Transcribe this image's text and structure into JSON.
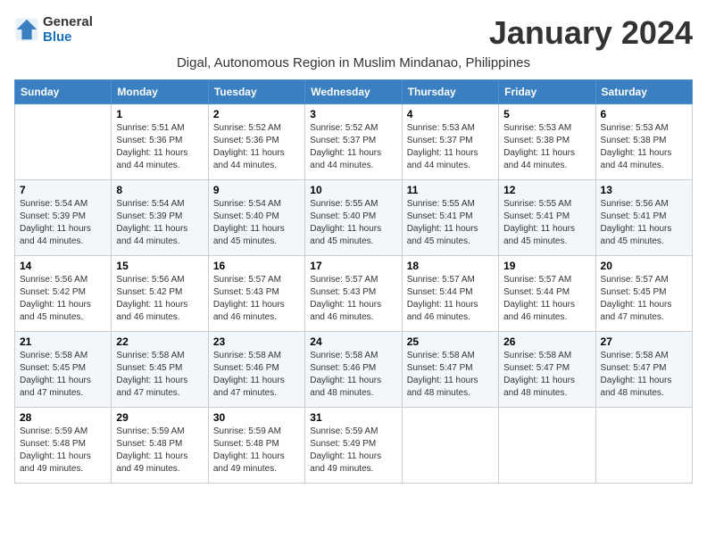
{
  "logo": {
    "general": "General",
    "blue": "Blue"
  },
  "title": "January 2024",
  "subtitle": "Digal, Autonomous Region in Muslim Mindanao, Philippines",
  "headers": [
    "Sunday",
    "Monday",
    "Tuesday",
    "Wednesday",
    "Thursday",
    "Friday",
    "Saturday"
  ],
  "weeks": [
    [
      {
        "day": "",
        "sunrise": "",
        "sunset": "",
        "daylight": ""
      },
      {
        "day": "1",
        "sunrise": "Sunrise: 5:51 AM",
        "sunset": "Sunset: 5:36 PM",
        "daylight": "Daylight: 11 hours and 44 minutes."
      },
      {
        "day": "2",
        "sunrise": "Sunrise: 5:52 AM",
        "sunset": "Sunset: 5:36 PM",
        "daylight": "Daylight: 11 hours and 44 minutes."
      },
      {
        "day": "3",
        "sunrise": "Sunrise: 5:52 AM",
        "sunset": "Sunset: 5:37 PM",
        "daylight": "Daylight: 11 hours and 44 minutes."
      },
      {
        "day": "4",
        "sunrise": "Sunrise: 5:53 AM",
        "sunset": "Sunset: 5:37 PM",
        "daylight": "Daylight: 11 hours and 44 minutes."
      },
      {
        "day": "5",
        "sunrise": "Sunrise: 5:53 AM",
        "sunset": "Sunset: 5:38 PM",
        "daylight": "Daylight: 11 hours and 44 minutes."
      },
      {
        "day": "6",
        "sunrise": "Sunrise: 5:53 AM",
        "sunset": "Sunset: 5:38 PM",
        "daylight": "Daylight: 11 hours and 44 minutes."
      }
    ],
    [
      {
        "day": "7",
        "sunrise": "Sunrise: 5:54 AM",
        "sunset": "Sunset: 5:39 PM",
        "daylight": "Daylight: 11 hours and 44 minutes."
      },
      {
        "day": "8",
        "sunrise": "Sunrise: 5:54 AM",
        "sunset": "Sunset: 5:39 PM",
        "daylight": "Daylight: 11 hours and 44 minutes."
      },
      {
        "day": "9",
        "sunrise": "Sunrise: 5:54 AM",
        "sunset": "Sunset: 5:40 PM",
        "daylight": "Daylight: 11 hours and 45 minutes."
      },
      {
        "day": "10",
        "sunrise": "Sunrise: 5:55 AM",
        "sunset": "Sunset: 5:40 PM",
        "daylight": "Daylight: 11 hours and 45 minutes."
      },
      {
        "day": "11",
        "sunrise": "Sunrise: 5:55 AM",
        "sunset": "Sunset: 5:41 PM",
        "daylight": "Daylight: 11 hours and 45 minutes."
      },
      {
        "day": "12",
        "sunrise": "Sunrise: 5:55 AM",
        "sunset": "Sunset: 5:41 PM",
        "daylight": "Daylight: 11 hours and 45 minutes."
      },
      {
        "day": "13",
        "sunrise": "Sunrise: 5:56 AM",
        "sunset": "Sunset: 5:41 PM",
        "daylight": "Daylight: 11 hours and 45 minutes."
      }
    ],
    [
      {
        "day": "14",
        "sunrise": "Sunrise: 5:56 AM",
        "sunset": "Sunset: 5:42 PM",
        "daylight": "Daylight: 11 hours and 45 minutes."
      },
      {
        "day": "15",
        "sunrise": "Sunrise: 5:56 AM",
        "sunset": "Sunset: 5:42 PM",
        "daylight": "Daylight: 11 hours and 46 minutes."
      },
      {
        "day": "16",
        "sunrise": "Sunrise: 5:57 AM",
        "sunset": "Sunset: 5:43 PM",
        "daylight": "Daylight: 11 hours and 46 minutes."
      },
      {
        "day": "17",
        "sunrise": "Sunrise: 5:57 AM",
        "sunset": "Sunset: 5:43 PM",
        "daylight": "Daylight: 11 hours and 46 minutes."
      },
      {
        "day": "18",
        "sunrise": "Sunrise: 5:57 AM",
        "sunset": "Sunset: 5:44 PM",
        "daylight": "Daylight: 11 hours and 46 minutes."
      },
      {
        "day": "19",
        "sunrise": "Sunrise: 5:57 AM",
        "sunset": "Sunset: 5:44 PM",
        "daylight": "Daylight: 11 hours and 46 minutes."
      },
      {
        "day": "20",
        "sunrise": "Sunrise: 5:57 AM",
        "sunset": "Sunset: 5:45 PM",
        "daylight": "Daylight: 11 hours and 47 minutes."
      }
    ],
    [
      {
        "day": "21",
        "sunrise": "Sunrise: 5:58 AM",
        "sunset": "Sunset: 5:45 PM",
        "daylight": "Daylight: 11 hours and 47 minutes."
      },
      {
        "day": "22",
        "sunrise": "Sunrise: 5:58 AM",
        "sunset": "Sunset: 5:45 PM",
        "daylight": "Daylight: 11 hours and 47 minutes."
      },
      {
        "day": "23",
        "sunrise": "Sunrise: 5:58 AM",
        "sunset": "Sunset: 5:46 PM",
        "daylight": "Daylight: 11 hours and 47 minutes."
      },
      {
        "day": "24",
        "sunrise": "Sunrise: 5:58 AM",
        "sunset": "Sunset: 5:46 PM",
        "daylight": "Daylight: 11 hours and 48 minutes."
      },
      {
        "day": "25",
        "sunrise": "Sunrise: 5:58 AM",
        "sunset": "Sunset: 5:47 PM",
        "daylight": "Daylight: 11 hours and 48 minutes."
      },
      {
        "day": "26",
        "sunrise": "Sunrise: 5:58 AM",
        "sunset": "Sunset: 5:47 PM",
        "daylight": "Daylight: 11 hours and 48 minutes."
      },
      {
        "day": "27",
        "sunrise": "Sunrise: 5:58 AM",
        "sunset": "Sunset: 5:47 PM",
        "daylight": "Daylight: 11 hours and 48 minutes."
      }
    ],
    [
      {
        "day": "28",
        "sunrise": "Sunrise: 5:59 AM",
        "sunset": "Sunset: 5:48 PM",
        "daylight": "Daylight: 11 hours and 49 minutes."
      },
      {
        "day": "29",
        "sunrise": "Sunrise: 5:59 AM",
        "sunset": "Sunset: 5:48 PM",
        "daylight": "Daylight: 11 hours and 49 minutes."
      },
      {
        "day": "30",
        "sunrise": "Sunrise: 5:59 AM",
        "sunset": "Sunset: 5:48 PM",
        "daylight": "Daylight: 11 hours and 49 minutes."
      },
      {
        "day": "31",
        "sunrise": "Sunrise: 5:59 AM",
        "sunset": "Sunset: 5:49 PM",
        "daylight": "Daylight: 11 hours and 49 minutes."
      },
      {
        "day": "",
        "sunrise": "",
        "sunset": "",
        "daylight": ""
      },
      {
        "day": "",
        "sunrise": "",
        "sunset": "",
        "daylight": ""
      },
      {
        "day": "",
        "sunrise": "",
        "sunset": "",
        "daylight": ""
      }
    ]
  ]
}
